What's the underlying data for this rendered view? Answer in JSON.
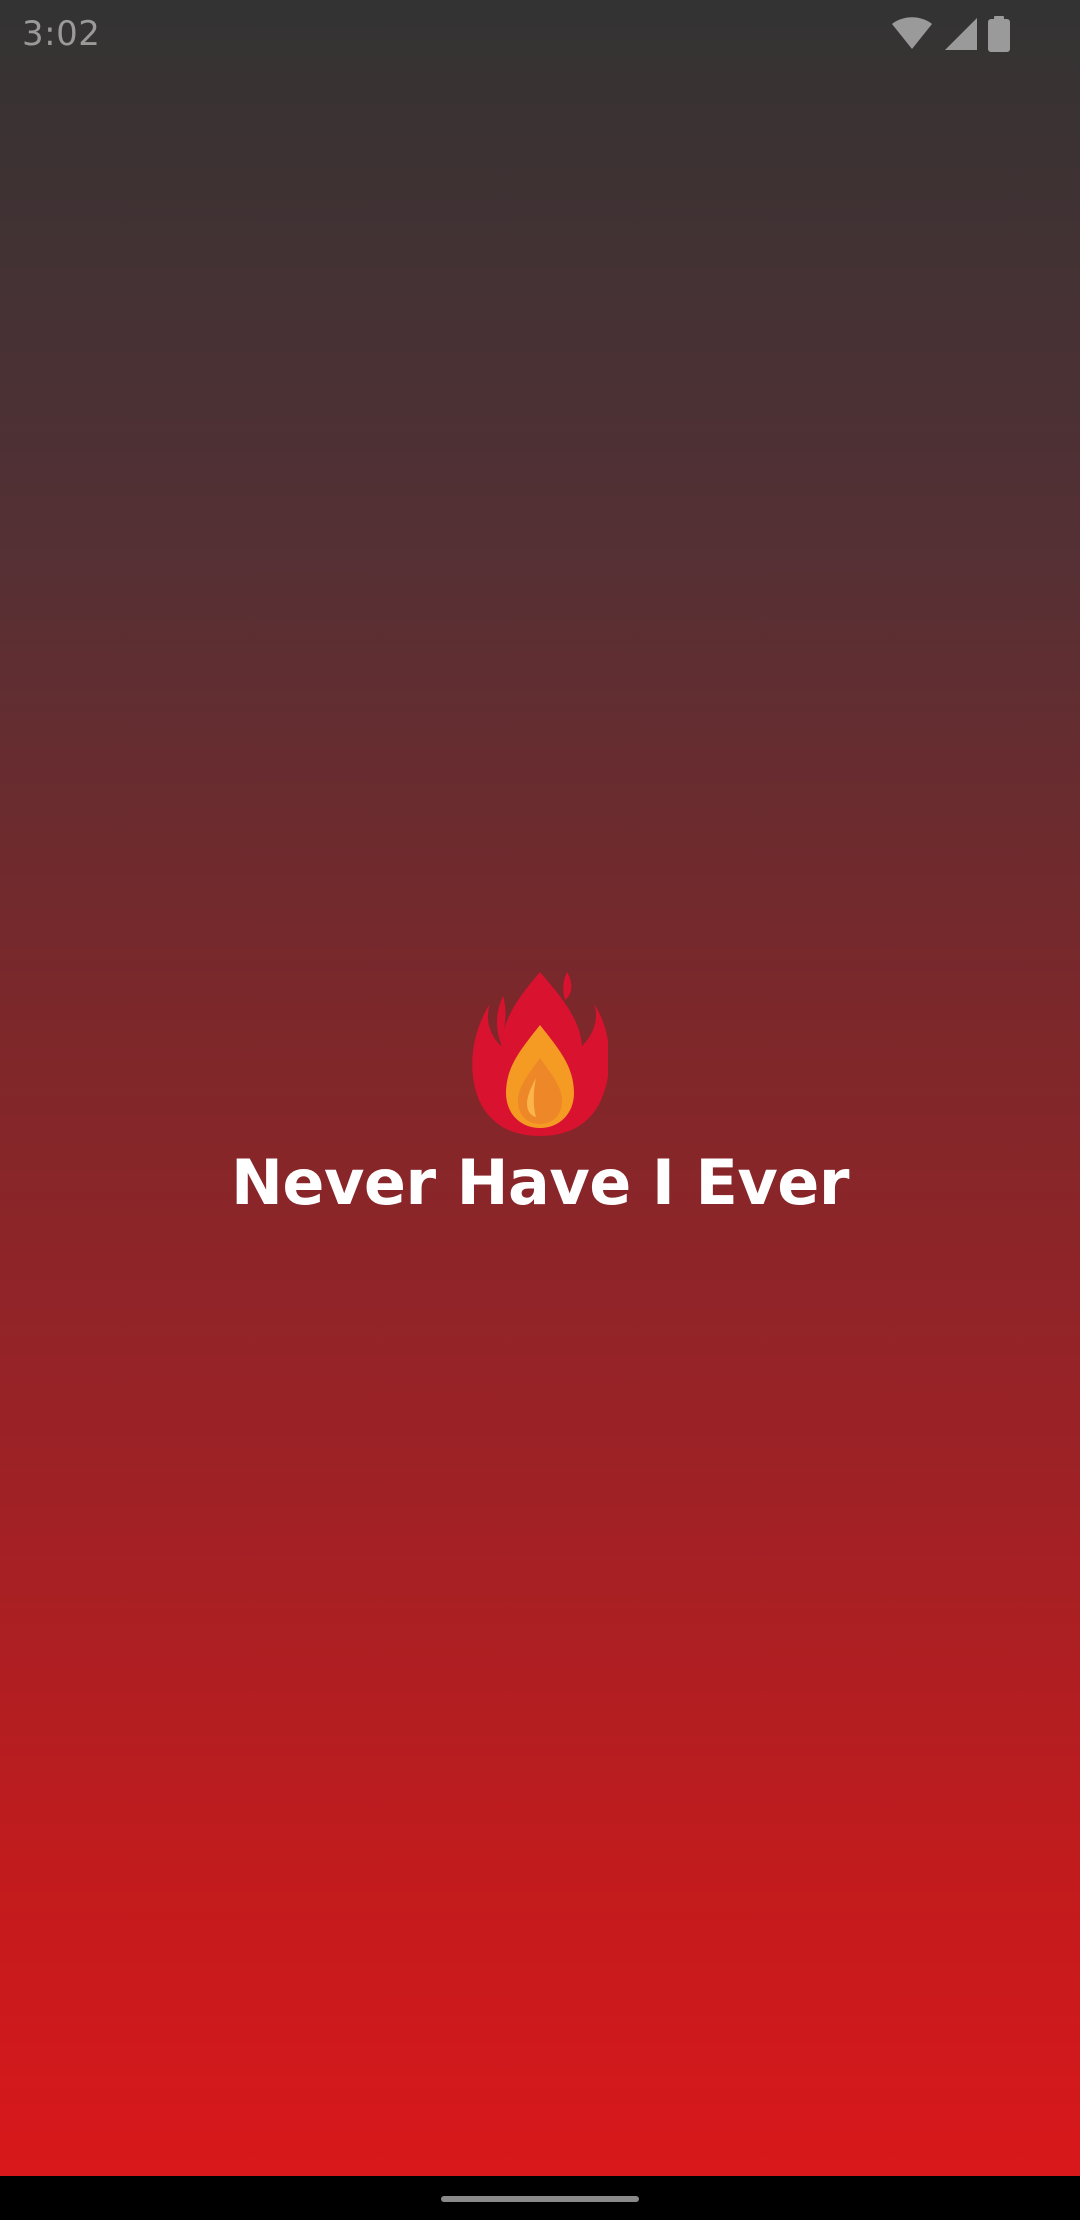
{
  "status_bar": {
    "time": "3:02",
    "icons": [
      "wifi-icon",
      "cellular-signal-icon",
      "battery-icon"
    ]
  },
  "splash": {
    "logo_icon": "fire-icon",
    "title": "Never Have I Ever"
  },
  "colors": {
    "gradient_top": "#333333",
    "gradient_bottom": "#dc171a",
    "title_text": "#ffffff",
    "status_text": "#9a9a9a",
    "nav_bar": "#000000"
  },
  "navigation": {
    "home_indicator": "home-indicator"
  }
}
